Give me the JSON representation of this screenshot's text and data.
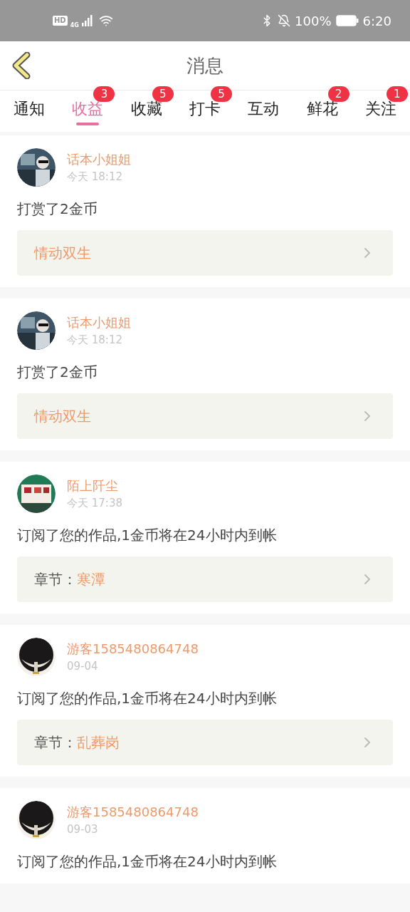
{
  "status_bar": {
    "hd": "HD",
    "network": "4G",
    "battery": "100%",
    "time": "6:20"
  },
  "header": {
    "title": "消息"
  },
  "tabs": [
    {
      "label": "通知",
      "selected": false
    },
    {
      "label": "收益",
      "selected": true,
      "badge": "3"
    },
    {
      "label": "收藏",
      "selected": false,
      "badge": "5"
    },
    {
      "label": "打卡",
      "selected": false,
      "badge": "5"
    },
    {
      "label": "互动",
      "selected": false
    },
    {
      "label": "鲜花",
      "selected": false,
      "badge": "2"
    },
    {
      "label": "关注",
      "selected": false,
      "badge": "1"
    }
  ],
  "messages": [
    {
      "user": "话本小姐姐",
      "time": "今天 18:12",
      "text": "打赏了2金币",
      "link": {
        "title": "情动双生"
      }
    },
    {
      "user": "话本小姐姐",
      "time": "今天 18:12",
      "text": "打赏了2金币",
      "link": {
        "title": "情动双生"
      }
    },
    {
      "user": "陌上阡尘",
      "time": "今天 17:38",
      "text": "订阅了您的作品,1金币将在24小时内到帐",
      "link": {
        "label": "章节：",
        "title": "寒潭"
      }
    },
    {
      "user": "游客1585480864748",
      "time": "09-04",
      "text": "订阅了您的作品,1金币将在24小时内到帐",
      "link": {
        "label": "章节：",
        "title": "乱葬岗"
      }
    },
    {
      "user": "游客1585480864748",
      "time": "09-03",
      "text": "订阅了您的作品,1金币将在24小时内到帐"
    }
  ]
}
